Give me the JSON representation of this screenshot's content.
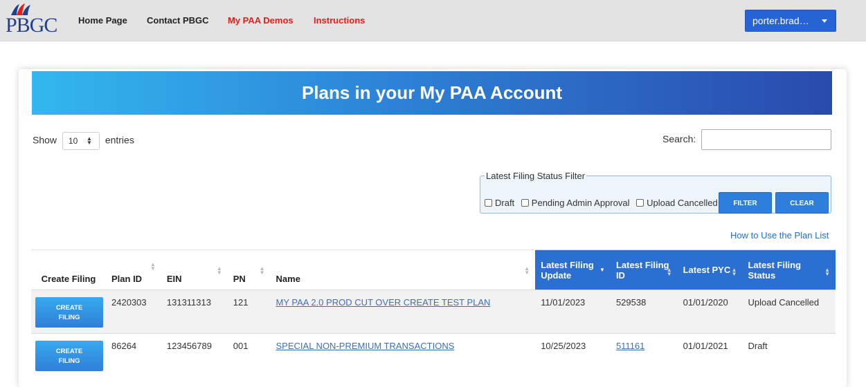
{
  "nav": {
    "logo_text": "PBGC",
    "home": "Home Page",
    "contact": "Contact PBGC",
    "demos": "My PAA Demos",
    "instructions": "Instructions",
    "user": "porter.brad…"
  },
  "page": {
    "title": "Plans in your My PAA Account",
    "show_label": "Show",
    "entries_label": "entries",
    "entries_value": "10",
    "search_label": "Search:",
    "search_value": "",
    "how_to_link": "How to Use the Plan List"
  },
  "filter": {
    "legend": "Latest Filing Status Filter",
    "options": [
      "Draft",
      "Pending Admin Approval",
      "Upload Cancelled"
    ],
    "filter_button": "FILTER",
    "clear_button": "CLEAR"
  },
  "table": {
    "headers": {
      "create_filing": "Create Filing",
      "plan_id": "Plan ID",
      "ein": "EIN",
      "pn": "PN",
      "name": "Name",
      "latest_update": "Latest Filing Update",
      "latest_filing_id": "Latest Filing ID",
      "latest_pyc": "Latest PYC",
      "latest_status": "Latest Filing Status"
    },
    "create_button_line1": "CREATE",
    "create_button_line2": "FILING",
    "rows": [
      {
        "plan_id": "2420303",
        "ein": "131311313",
        "pn": "121",
        "name": "MY PAA 2.0 PROD CUT OVER CREATE TEST PLAN",
        "update": "11/01/2023",
        "filing_id": "529538",
        "pyc": "01/01/2020",
        "status": "Upload Cancelled"
      },
      {
        "plan_id": "86264",
        "ein": "123456789",
        "pn": "001",
        "name": "SPECIAL NON-PREMIUM TRANSACTIONS",
        "update": "10/25/2023",
        "filing_id": "511161",
        "pyc": "01/01/2021",
        "status": "Draft"
      }
    ]
  },
  "colors": {
    "accent_blue": "#2b6fd0",
    "nav_red": "#e0201b"
  }
}
